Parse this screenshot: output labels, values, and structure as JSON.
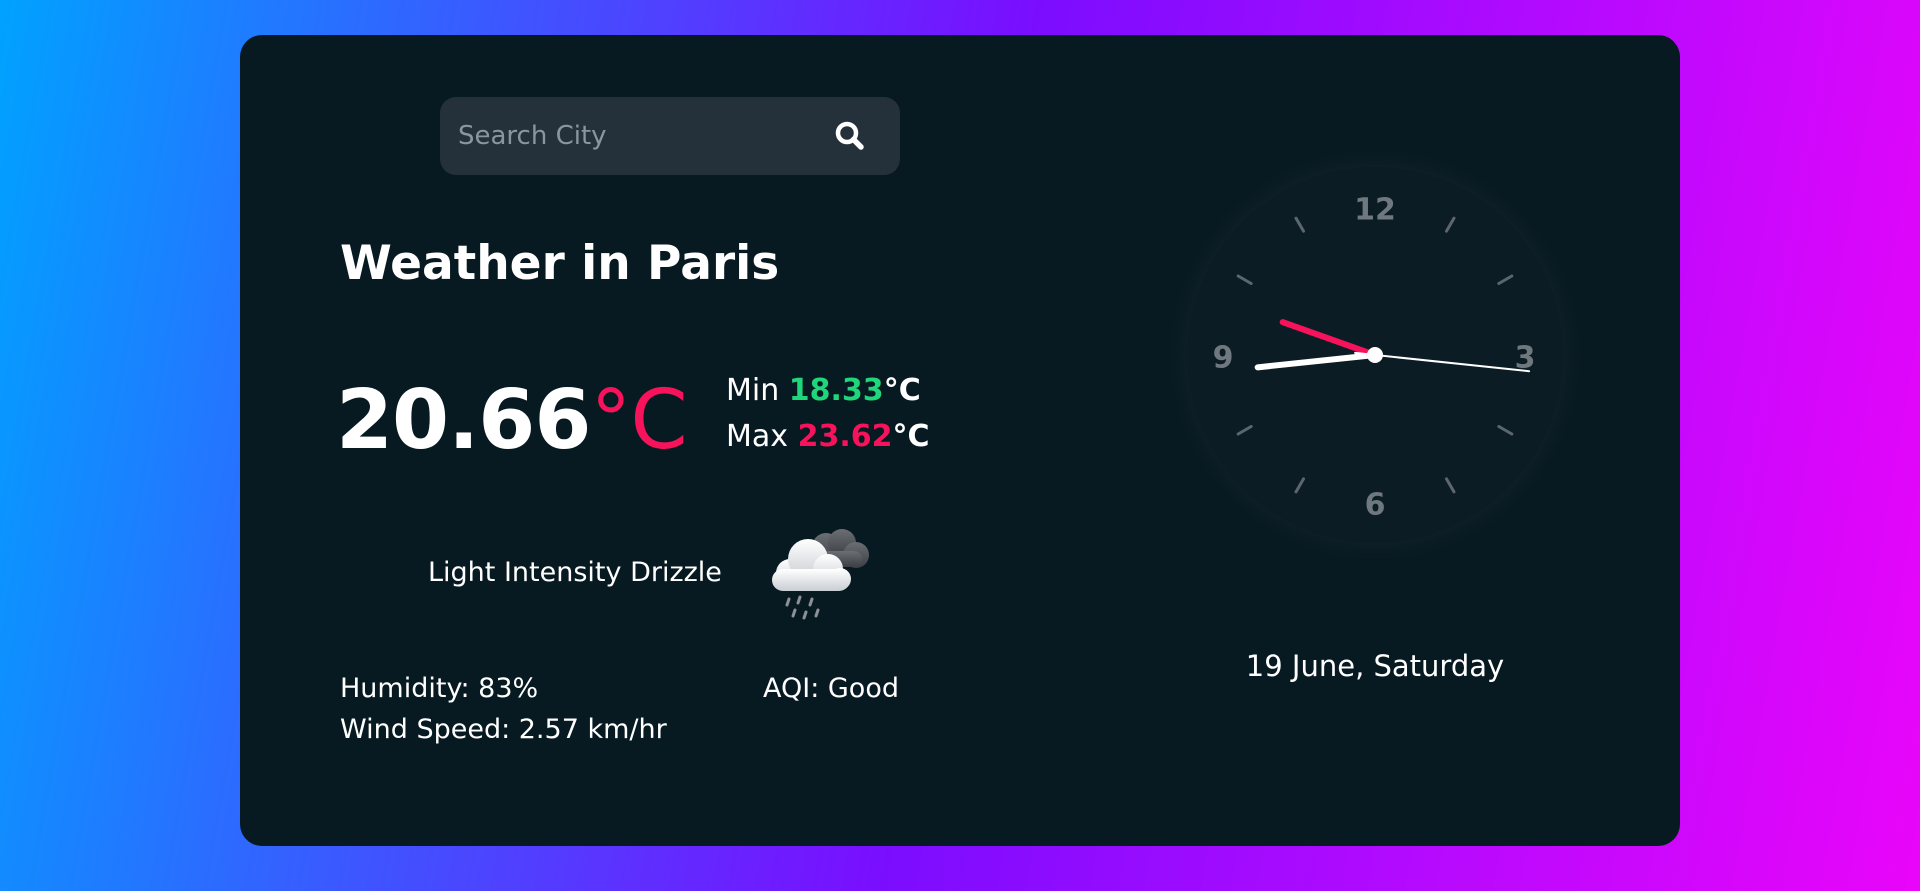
{
  "search": {
    "placeholder": "Search City",
    "value": "",
    "icon": "search-icon"
  },
  "weather": {
    "title": "Weather in Paris",
    "temperature": "20.66",
    "temp_unit": "°C",
    "min_label": "Min",
    "min_value": "18.33",
    "max_label": "Max",
    "max_value": "23.62",
    "unit": "°C",
    "description": "Light Intensity Drizzle",
    "icon": "drizzle-cloud-icon",
    "humidity": "Humidity: 83%",
    "wind_speed": "Wind Speed: 2.57 km/hr",
    "aqi": "AQI: Good"
  },
  "clock": {
    "numerals": [
      "12",
      "3",
      "6",
      "9"
    ],
    "time": {
      "hour": 8,
      "minute": 48,
      "second": 16
    }
  },
  "date": "19 June, Saturday",
  "colors": {
    "card_background": "#081a21",
    "accent_red": "#f7125c",
    "accent_green": "#1fd67a",
    "search_background": "#24313a"
  }
}
